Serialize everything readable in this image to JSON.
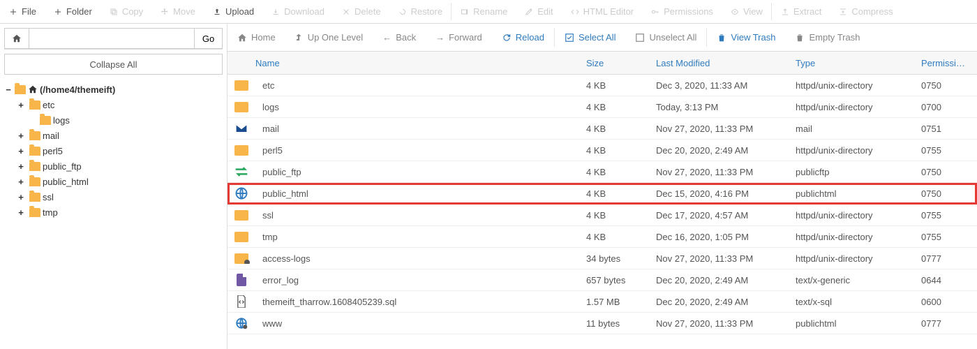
{
  "toolbar": [
    {
      "id": "file",
      "label": "File",
      "icon": "plus",
      "enabled": true
    },
    {
      "id": "folder",
      "label": "Folder",
      "icon": "plus",
      "enabled": true
    },
    {
      "id": "copy",
      "label": "Copy",
      "icon": "copy",
      "enabled": false
    },
    {
      "id": "move",
      "label": "Move",
      "icon": "move",
      "enabled": false
    },
    {
      "id": "upload",
      "label": "Upload",
      "icon": "upload",
      "enabled": true
    },
    {
      "id": "download",
      "label": "Download",
      "icon": "download",
      "enabled": false
    },
    {
      "id": "delete",
      "label": "Delete",
      "icon": "delete",
      "enabled": false
    },
    {
      "id": "restore",
      "label": "Restore",
      "icon": "restore",
      "enabled": false
    },
    {
      "sep": true
    },
    {
      "id": "rename",
      "label": "Rename",
      "icon": "rename",
      "enabled": false
    },
    {
      "id": "edit",
      "label": "Edit",
      "icon": "edit",
      "enabled": false
    },
    {
      "id": "html",
      "label": "HTML Editor",
      "icon": "html",
      "enabled": false
    },
    {
      "id": "perms",
      "label": "Permissions",
      "icon": "key",
      "enabled": false
    },
    {
      "id": "view",
      "label": "View",
      "icon": "eye",
      "enabled": false
    },
    {
      "sep": true
    },
    {
      "id": "extract",
      "label": "Extract",
      "icon": "extract",
      "enabled": false
    },
    {
      "id": "compress",
      "label": "Compress",
      "icon": "compress",
      "enabled": false
    }
  ],
  "path_bar": {
    "go_label": "Go",
    "path_value": ""
  },
  "collapse_label": "Collapse All",
  "tree": {
    "root": {
      "label": "(/home4/themeift)",
      "expanded": true
    },
    "children": [
      {
        "label": "etc",
        "expandable": true
      },
      {
        "label": "logs",
        "expandable": false
      },
      {
        "label": "mail",
        "expandable": true
      },
      {
        "label": "perl5",
        "expandable": true
      },
      {
        "label": "public_ftp",
        "expandable": true
      },
      {
        "label": "public_html",
        "expandable": true
      },
      {
        "label": "ssl",
        "expandable": true
      },
      {
        "label": "tmp",
        "expandable": true
      }
    ]
  },
  "nav": {
    "home": "Home",
    "up": "Up One Level",
    "back": "Back",
    "forward": "Forward",
    "reload": "Reload",
    "select_all": "Select All",
    "unselect_all": "Unselect All",
    "view_trash": "View Trash",
    "empty_trash": "Empty Trash"
  },
  "columns": {
    "name": "Name",
    "size": "Size",
    "modified": "Last Modified",
    "type": "Type",
    "perm": "Permissions"
  },
  "rows": [
    {
      "icon": "folder",
      "name": "etc",
      "size": "4 KB",
      "modified": "Dec 3, 2020, 11:33 AM",
      "type": "httpd/unix-directory",
      "perm": "0750"
    },
    {
      "icon": "folder",
      "name": "logs",
      "size": "4 KB",
      "modified": "Today, 3:13 PM",
      "type": "httpd/unix-directory",
      "perm": "0700"
    },
    {
      "icon": "mail",
      "name": "mail",
      "size": "4 KB",
      "modified": "Nov 27, 2020, 11:33 PM",
      "type": "mail",
      "perm": "0751"
    },
    {
      "icon": "folder",
      "name": "perl5",
      "size": "4 KB",
      "modified": "Dec 20, 2020, 2:49 AM",
      "type": "httpd/unix-directory",
      "perm": "0755"
    },
    {
      "icon": "ftp",
      "name": "public_ftp",
      "size": "4 KB",
      "modified": "Nov 27, 2020, 11:33 PM",
      "type": "publicftp",
      "perm": "0750"
    },
    {
      "icon": "globe",
      "name": "public_html",
      "size": "4 KB",
      "modified": "Dec 15, 2020, 4:16 PM",
      "type": "publichtml",
      "perm": "0750",
      "highlight": true
    },
    {
      "icon": "folder",
      "name": "ssl",
      "size": "4 KB",
      "modified": "Dec 17, 2020, 4:57 AM",
      "type": "httpd/unix-directory",
      "perm": "0755"
    },
    {
      "icon": "folder",
      "name": "tmp",
      "size": "4 KB",
      "modified": "Dec 16, 2020, 1:05 PM",
      "type": "httpd/unix-directory",
      "perm": "0755"
    },
    {
      "icon": "folder-link",
      "name": "access-logs",
      "size": "34 bytes",
      "modified": "Nov 27, 2020, 11:33 PM",
      "type": "httpd/unix-directory",
      "perm": "0777"
    },
    {
      "icon": "file",
      "name": "error_log",
      "size": "657 bytes",
      "modified": "Dec 20, 2020, 2:49 AM",
      "type": "text/x-generic",
      "perm": "0644"
    },
    {
      "icon": "file-code",
      "name": "themeift_tharrow.1608405239.sql",
      "size": "1.57 MB",
      "modified": "Dec 20, 2020, 2:49 AM",
      "type": "text/x-sql",
      "perm": "0600"
    },
    {
      "icon": "globe-link",
      "name": "www",
      "size": "11 bytes",
      "modified": "Nov 27, 2020, 11:33 PM",
      "type": "publichtml",
      "perm": "0777"
    }
  ]
}
